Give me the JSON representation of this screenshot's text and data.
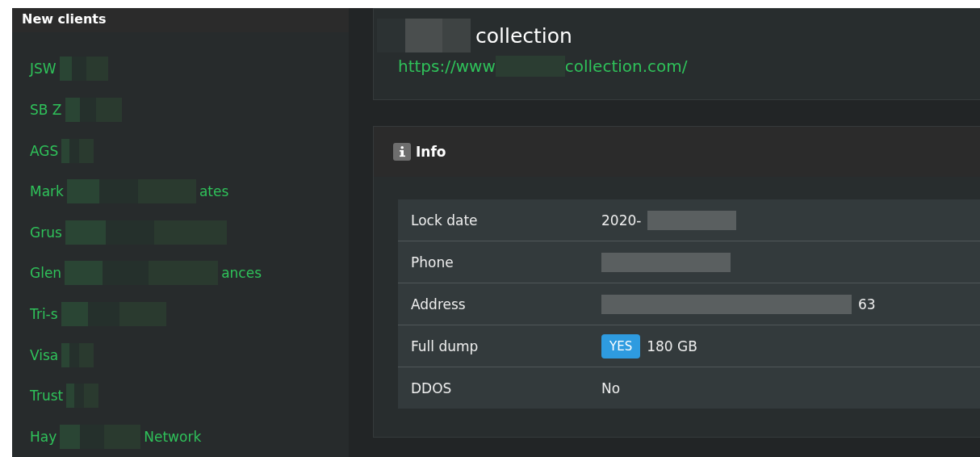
{
  "clients_panel": {
    "title": "New clients",
    "items": [
      {
        "start": "JSW"
      },
      {
        "start": "SB Z"
      },
      {
        "start": "AGS"
      },
      {
        "start": "Mark",
        "end": "ates"
      },
      {
        "start": "Grus"
      },
      {
        "start": "Glen",
        "end": "ances"
      },
      {
        "start": "Tri-s"
      },
      {
        "start": "Visa"
      },
      {
        "start": "Trust"
      },
      {
        "start": "Hay",
        "end": "Network"
      }
    ]
  },
  "site_card": {
    "title": "collection",
    "url_start": "https://www",
    "url_end": "collection.com/"
  },
  "info_card": {
    "title": "Info",
    "rows": [
      {
        "label": "Lock date",
        "kind": "text",
        "value": "2020-"
      },
      {
        "label": "Phone",
        "kind": "text"
      },
      {
        "label": "Address",
        "kind": "text",
        "value": "63"
      },
      {
        "label": "Full dump",
        "kind": "badge",
        "badge": "YES",
        "value": "180 GB"
      },
      {
        "label": "DDOS",
        "kind": "text",
        "value": "No"
      }
    ]
  }
}
